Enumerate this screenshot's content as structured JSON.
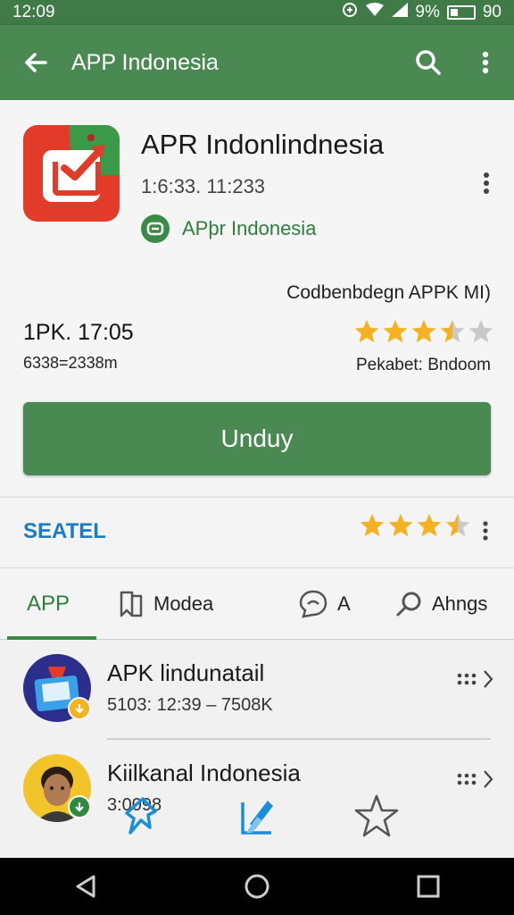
{
  "status_bar": {
    "time": "12:09",
    "battery": "9%",
    "extra": "90"
  },
  "app_bar": {
    "title": "APP Indonesia"
  },
  "app": {
    "name": "APR Indonlindnesia",
    "meta": "1:6:33. 11:233",
    "developer": "APþr Indonesia",
    "compat_text": "Codbenbdegn APPK MI)",
    "size_main": "1PK. 17:05",
    "size_sub": "6338=2338m",
    "package_text": "Pekabet: Bndoom",
    "rating": 3.5,
    "install_label": "Unduy"
  },
  "rated": {
    "label": "SEATEL",
    "rating": 3.5
  },
  "tabs": [
    {
      "label": "APP",
      "icon": "app-tab"
    },
    {
      "label": "Modea",
      "icon": "book-icon"
    },
    {
      "label": "A",
      "icon": "chat-icon"
    },
    {
      "label": "Ahngs",
      "icon": "search-icon"
    }
  ],
  "list": [
    {
      "name": "APK lindunatail",
      "sub": "5103: 12:39 – 7508K"
    },
    {
      "name": "Kiilkanal Indonesia",
      "sub": "3:0098"
    }
  ],
  "colors": {
    "primary": "#4a8a52",
    "accent_blue": "#1a7cc3",
    "star": "#f4b223"
  }
}
